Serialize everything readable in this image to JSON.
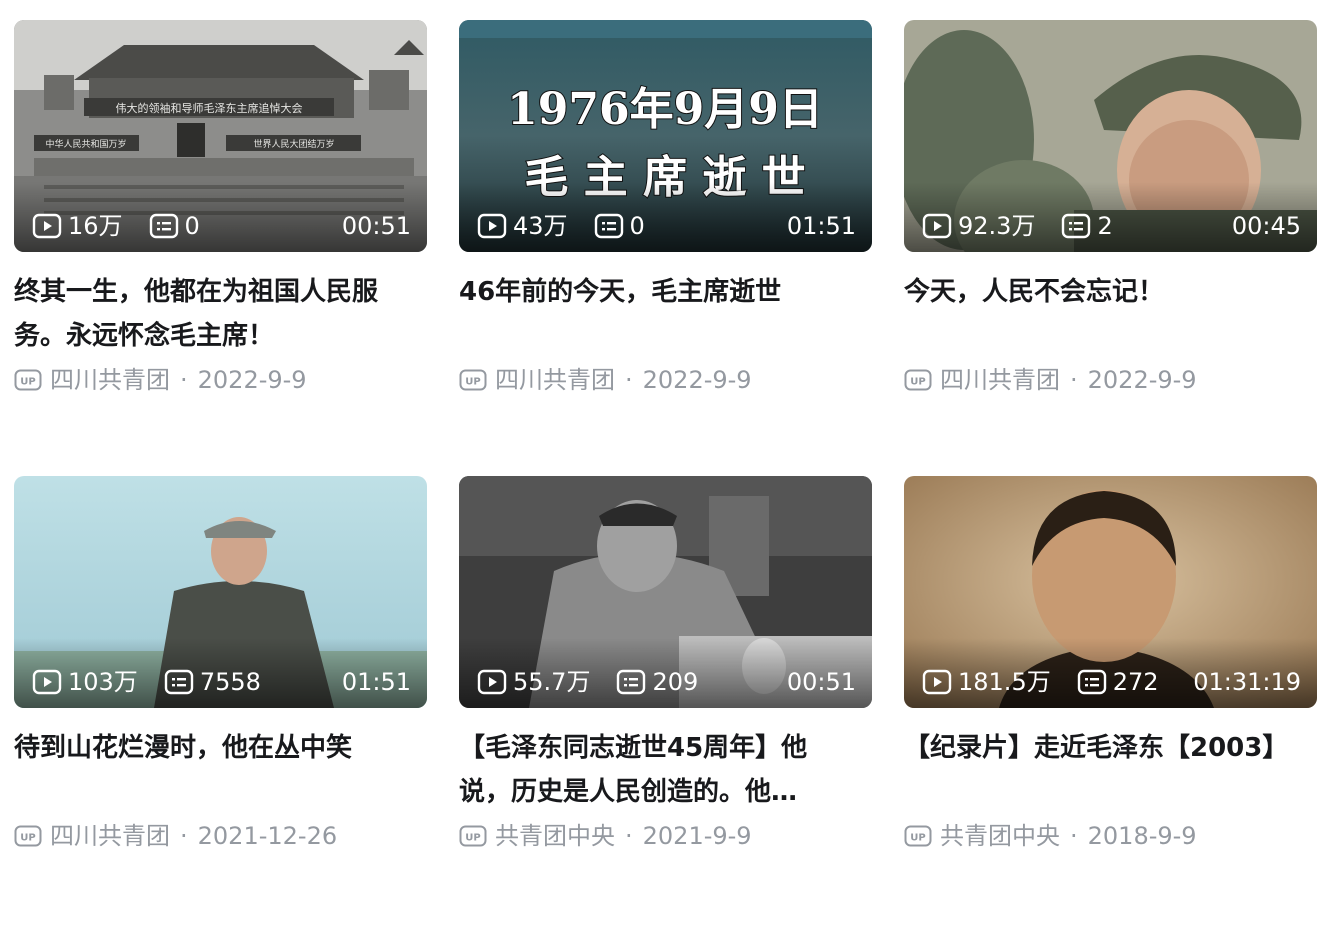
{
  "cards": [
    {
      "views": "16万",
      "comments": "0",
      "duration": "00:51",
      "title": "终其一生，他都在为祖国人民服务。永远怀念毛主席！",
      "uploader": "四川共青团",
      "date": "2022-9-9",
      "thumb_banner": "伟大的领袖和导师毛泽东主席追悼大会",
      "thumb_left": "中华人民共和国万岁",
      "thumb_right": "世界人民大团结万岁"
    },
    {
      "views": "43万",
      "comments": "0",
      "duration": "01:51",
      "title": "46年前的今天，毛主席逝世",
      "uploader": "四川共青团",
      "date": "2022-9-9",
      "thumb_line1": "1976年9月9日",
      "thumb_line2": "毛 主 席 逝 世"
    },
    {
      "views": "92.3万",
      "comments": "2",
      "duration": "00:45",
      "title": "今天，人民不会忘记！",
      "uploader": "四川共青团",
      "date": "2022-9-9"
    },
    {
      "views": "103万",
      "comments": "7558",
      "duration": "01:51",
      "title": "待到山花烂漫时，他在丛中笑",
      "uploader": "四川共青团",
      "date": "2021-12-26"
    },
    {
      "views": "55.7万",
      "comments": "209",
      "duration": "00:51",
      "title": "【毛泽东同志逝世45周年】他说，历史是人民创造的。他…",
      "uploader": "共青团中央",
      "date": "2021-9-9"
    },
    {
      "views": "181.5万",
      "comments": "272",
      "duration": "01:31:19",
      "title": "【纪录片】走近毛泽东【2003】",
      "uploader": "共青团中央",
      "date": "2018-9-9"
    }
  ],
  "meta_separator": "·",
  "icons": {
    "views": "play-count-icon",
    "comments": "danmaku-icon",
    "uploader": "up-badge-icon"
  },
  "colors": {
    "meta": "#9499a0",
    "title": "#18191c",
    "overlay_text": "#ffffff"
  }
}
